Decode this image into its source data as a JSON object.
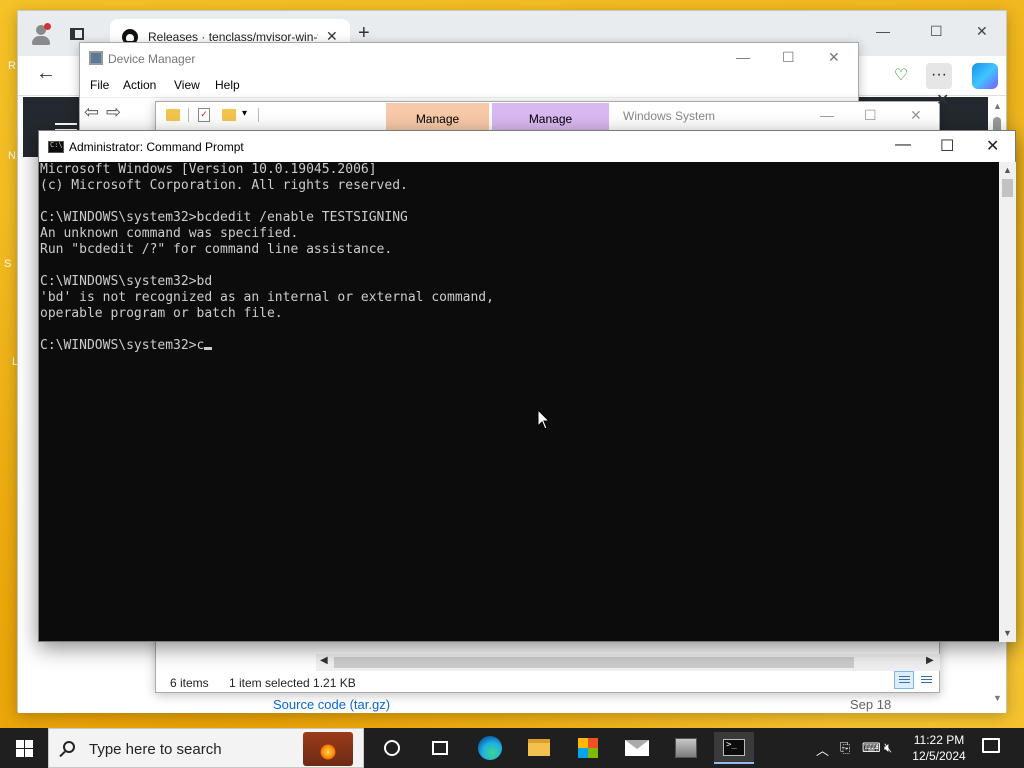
{
  "browser": {
    "tab_title": "Releases · tenclass/mvisor-win-vg",
    "tab_close": "✕",
    "new_tab": "+",
    "more_label": "···",
    "min": "—",
    "max": "☐",
    "close": "✕",
    "back": "←",
    "content": {
      "asset_link": "Source code (tar.gz)",
      "asset_date": "Sep 18"
    }
  },
  "device_manager": {
    "title": "Device Manager",
    "menu": [
      "File",
      "Action",
      "View",
      "Help"
    ],
    "min": "—",
    "max": "☐",
    "close": "✕"
  },
  "explorer": {
    "manage_tab_1": "Manage",
    "manage_tab_2": "Manage",
    "title": "Windows System",
    "min": "—",
    "max": "☐",
    "close": "✕",
    "status": {
      "items": "6 items",
      "selected": "1 item selected  1.21 KB"
    }
  },
  "cmd": {
    "title": "Administrator: Command Prompt",
    "min": "—",
    "max": "☐",
    "close": "✕",
    "lines": [
      "Microsoft Windows [Version 10.0.19045.2006]",
      "(c) Microsoft Corporation. All rights reserved.",
      "",
      "C:\\WINDOWS\\system32>bcdedit /enable TESTSIGNING",
      "An unknown command was specified.",
      "Run \"bcdedit /?\" for command line assistance.",
      "",
      "C:\\WINDOWS\\system32>bd",
      "'bd' is not recognized as an internal or external command,",
      "operable program or batch file.",
      "",
      "C:\\WINDOWS\\system32>c"
    ]
  },
  "taskbar": {
    "search_placeholder": "Type here to search",
    "time": "11:22 PM",
    "date": "12/5/2024",
    "apps": [
      "cortana",
      "task-view",
      "edge",
      "file-explorer",
      "microsoft-store",
      "mail",
      "device-manager",
      "command-prompt"
    ],
    "tray_chevron": "︿"
  },
  "colors": {
    "desktop_bg": "#f2b517",
    "cmd_bg": "#0c0c0c",
    "cmd_fg": "#cccccc",
    "manage_tab_1": "#f7c9a8",
    "manage_tab_2": "#d9b8f0",
    "taskbar": "#1f1f1f"
  }
}
